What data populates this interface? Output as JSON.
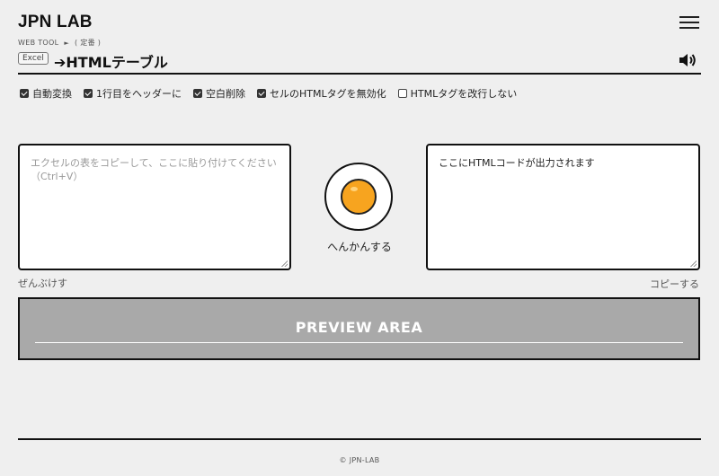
{
  "header": {
    "logo": "JPN LAB",
    "menu_icon": "hamburger-menu-icon"
  },
  "breadcrumb": {
    "items": [
      "WEB TOOL",
      "( 定番 )"
    ],
    "separator": "►"
  },
  "title": {
    "badge": "Excel",
    "text": "➔HTMLテーブル",
    "speaker_icon": "speaker-icon"
  },
  "options": [
    {
      "label": "自動変換",
      "checked": true
    },
    {
      "label": "1行目をヘッダーに",
      "checked": true
    },
    {
      "label": "空白削除",
      "checked": true
    },
    {
      "label": "セルのHTMLタグを無効化",
      "checked": true
    },
    {
      "label": "HTMLタグを改行しない",
      "checked": false
    }
  ],
  "input": {
    "placeholder": "エクセルの表をコピーして、ここに貼り付けてください（Ctrl+V）",
    "value": ""
  },
  "convert": {
    "label": "へんかんする",
    "icon": "egg-icon",
    "colors": {
      "yolk": "#f7a41f"
    }
  },
  "output": {
    "placeholder": "ここにHTMLコードが出力されます"
  },
  "actions": {
    "clear": "ぜんぶけす",
    "copy": "コピーする"
  },
  "preview": {
    "title": "PREVIEW AREA",
    "bg_color": "#a9a9a9"
  },
  "footer": {
    "copyright": "© JPN-LAB"
  }
}
